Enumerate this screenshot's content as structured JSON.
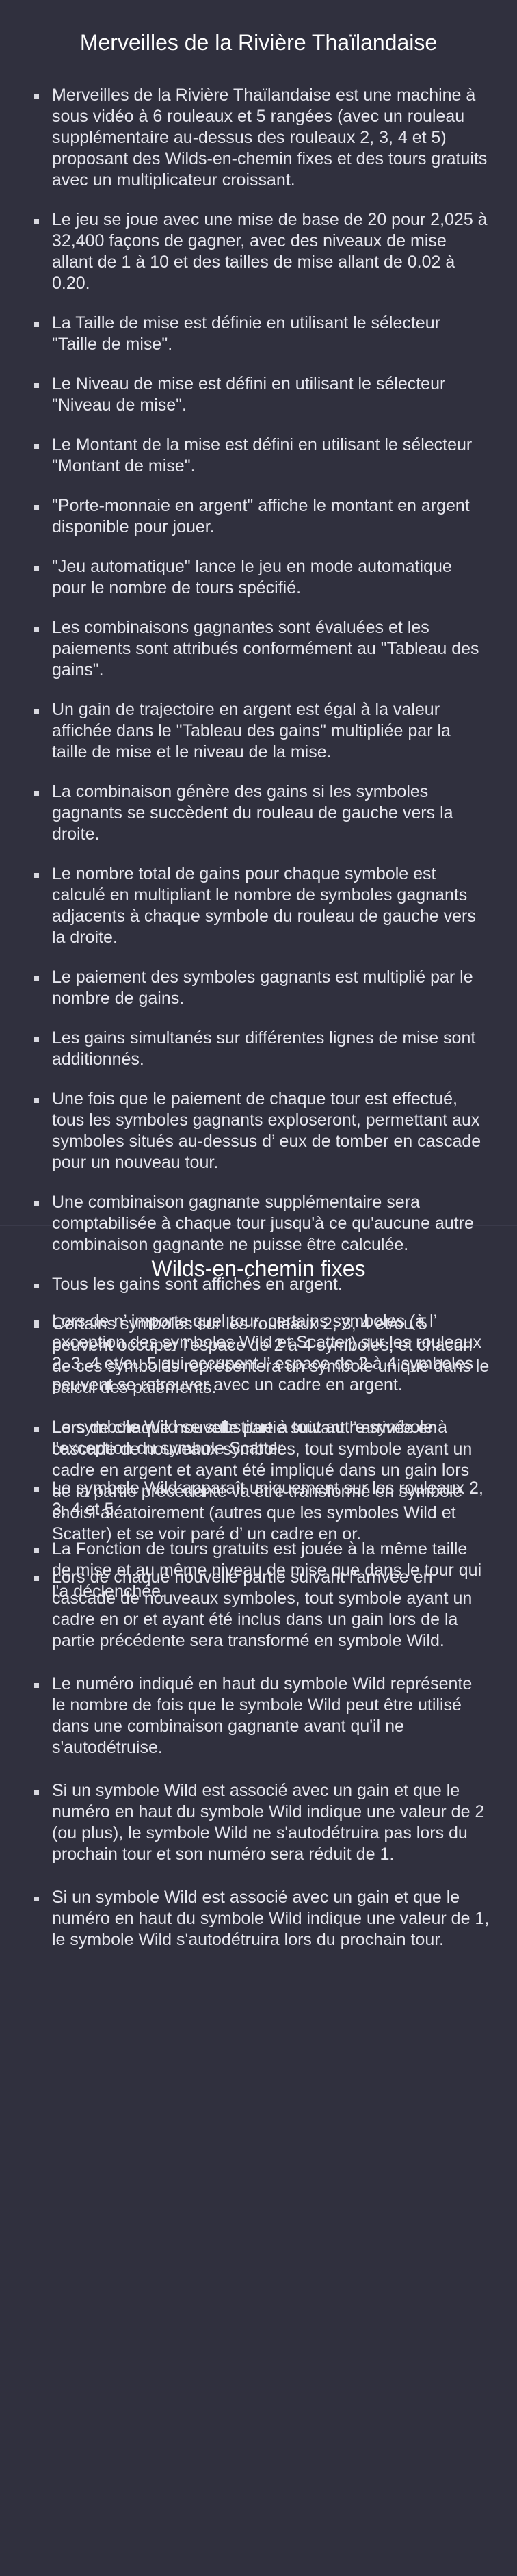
{
  "section1": {
    "title": "Merveilles de la Rivière Thaïlandaise",
    "items": [
      "Merveilles de la Rivière Thaïlandaise est une machine à sous vidéo à 6 rouleaux et 5 rangées (avec un rouleau supplémentaire au-dessus des rouleaux 2, 3, 4 et 5) proposant des Wilds-en-chemin fixes et des tours gratuits avec un multiplicateur croissant.",
      "Le jeu se joue avec une mise de base de 20 pour 2,025 à 32,400 façons de gagner, avec des niveaux de mise allant de 1 à 10 et des tailles de mise allant de 0.02 à 0.20.",
      "La Taille de mise est définie en utilisant le sélecteur \"Taille de mise\".",
      "Le Niveau de mise est défini en utilisant le sélecteur \"Niveau de mise\".",
      "Le Montant de la mise est défini en utilisant le sélecteur \"Montant de mise\".",
      "\"Porte-monnaie en argent\" affiche le montant en argent disponible pour jouer.",
      "\"Jeu automatique\" lance le jeu en mode automatique pour le nombre de tours spécifié.",
      "Les combinaisons gagnantes sont évaluées et les paiements sont attribués conformément au \"Tableau des gains\".",
      "Un gain de trajectoire en argent est égal à la valeur affichée dans le \"Tableau des gains\" multipliée par la taille de mise et le niveau de la mise.",
      "La combinaison génère des gains si les symboles gagnants se succèdent du rouleau de gauche vers la droite.",
      "Le nombre total de gains pour chaque symbole est calculé en multipliant le nombre de symboles gagnants adjacents à chaque symbole du rouleau de gauche vers la droite.",
      "Le paiement des symboles gagnants est multiplié par le nombre de gains.",
      "Les gains simultanés sur différentes lignes de mise sont additionnés.",
      "Une fois que le paiement de chaque tour est effectué, tous les symboles gagnants exploseront, permettant aux symboles situés au-dessus d’ eux de tomber en cascade pour un nouveau tour.",
      "Une combinaison gagnante supplémentaire sera comptabilisée à chaque tour jusqu'à ce qu'aucune autre combinaison gagnante ne puisse être calculée.",
      "Tous les gains sont affichés en argent.",
      "Certains symboles sur les rouleaux 2, 3, 4 et/ou 5 peuvent occuper l'espace de 2 à 4 symboles, et chacun de ces symboles représentera un symbole unique dans le calcul des paiements.",
      "Le symbole Wild se substitue à tout autre symbole à l'exception du symbole Scatter.",
      "Le symbole Wild apparaît uniquement sur les rouleaux 2, 3, 4 et 5.",
      "La Fonction de tours gratuits est jouée à la même taille de mise et au même niveau de mise que dans le tour qui l'a déclenchée."
    ]
  },
  "section2": {
    "title": "Wilds-en-chemin fixes",
    "items": [
      "Lors de n’ importe quel tour, certains symboles (à l’ exception des symboles Wild et Scatter) sur les rouleaux 2, 3, 4 et/ou 5 qui occupent l’ espace de 2 à 4 symboles peuvent se retrouver avec un cadre en argent.",
      "Lors de chaque nouvelle partie suivant l’ arrivée en cascade de nouveaux symboles, tout symbole ayant un cadre en argent et ayant été impliqué dans un gain lors de la partie précédente va être transformé en symbole choisi aléatoirement (autres que les symboles Wild et Scatter) et se voir paré d’ un cadre en or.",
      "Lors de chaque nouvelle partie suivant l'arrivée en cascade de nouveaux symboles, tout symbole ayant un cadre en or et ayant été inclus dans un gain lors de la partie précédente sera transformé en symbole Wild.",
      "Le numéro indiqué en haut du symbole Wild représente le nombre de fois que le symbole Wild peut être utilisé dans une combinaison gagnante avant qu'il ne s'autodétruise.",
      "Si un symbole Wild est associé avec un gain et que le numéro en haut du symbole Wild indique une valeur de 2 (ou plus), le symbole Wild ne s'autodétruira pas lors du prochain tour et son numéro sera réduit de 1.",
      "Si un symbole Wild est associé avec un gain et que le numéro en haut du symbole Wild indique une valeur de 1, le symbole Wild s'autodétruira lors du prochain tour."
    ]
  }
}
